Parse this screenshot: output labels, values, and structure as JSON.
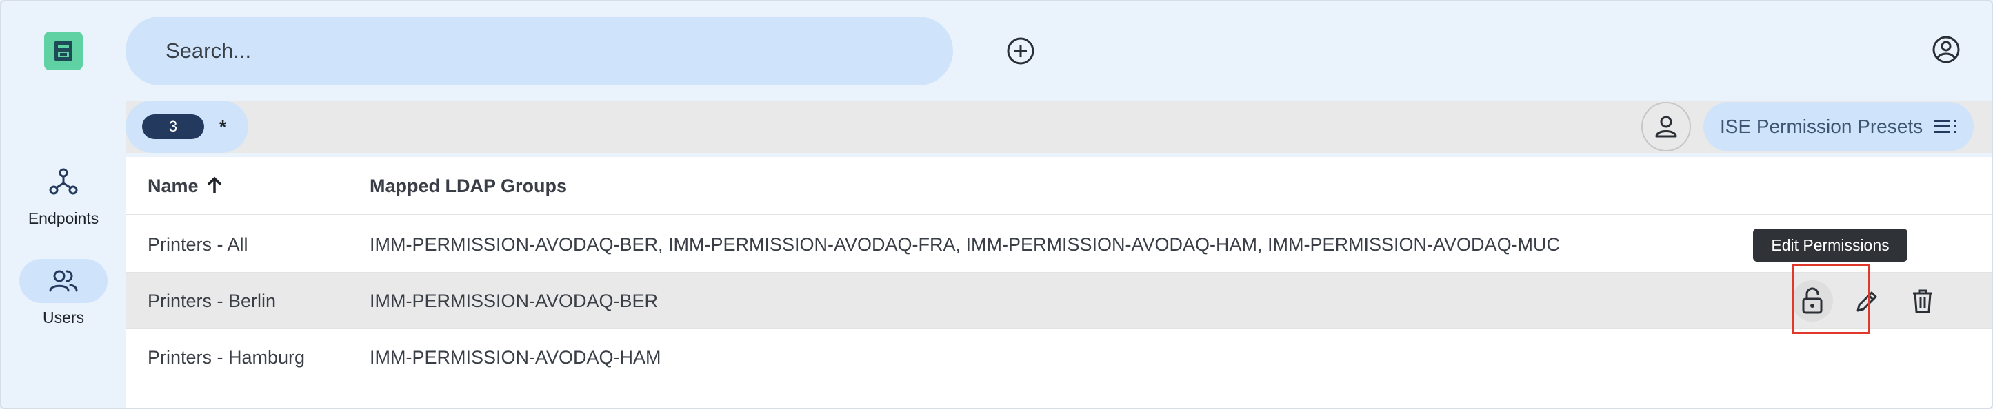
{
  "sidebar": {
    "items": [
      {
        "label": "Endpoints",
        "icon": "hub-icon",
        "active": false
      },
      {
        "label": "Users",
        "icon": "users-icon",
        "active": true
      }
    ]
  },
  "search": {
    "placeholder": "Search..."
  },
  "toolbar": {
    "filter_count": "3",
    "filter_symbol": "*",
    "preset_label": "ISE Permission Presets"
  },
  "table": {
    "columns": [
      {
        "label": "Name",
        "sort": "ascending"
      },
      {
        "label": "Mapped LDAP Groups"
      }
    ],
    "rows": [
      {
        "name": "Printers - All",
        "groups": "IMM-PERMISSION-AVODAQ-BER, IMM-PERMISSION-AVODAQ-FRA, IMM-PERMISSION-AVODAQ-HAM, IMM-PERMISSION-AVODAQ-MUC"
      },
      {
        "name": "Printers - Berlin",
        "groups": "IMM-PERMISSION-AVODAQ-BER"
      },
      {
        "name": "Printers - Hamburg",
        "groups": "IMM-PERMISSION-AVODAQ-HAM"
      }
    ]
  },
  "tooltip": {
    "text": "Edit Permissions"
  },
  "colors": {
    "accent": "#cfe4fb",
    "badge": "#23395d",
    "logo": "#5fd1a3",
    "highlight": "#e0392b"
  }
}
